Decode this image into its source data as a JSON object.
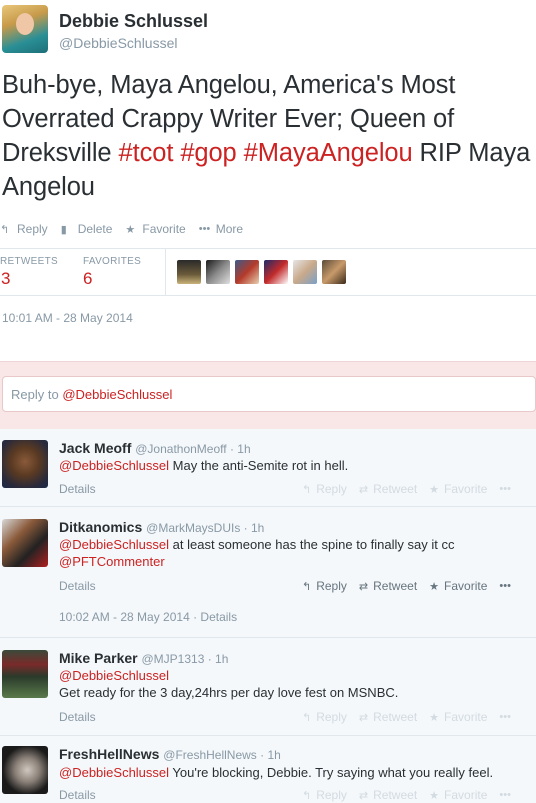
{
  "tweet": {
    "author_name": "Debbie Schlussel",
    "author_handle": "@DebbieSchlussel",
    "text_part1": "Buh-bye, Maya Angelou, America's Most Overrated Crappy Writer Ever; Queen of Dreksville ",
    "hashtag1": "#tcot",
    "hashtag2": "#gop",
    "hashtag3": "#MayaAngelou",
    "text_part2": " RIP Maya Angelou",
    "actions": {
      "reply": "Reply",
      "delete": "Delete",
      "favorite": "Favorite",
      "more": "More"
    },
    "stats": {
      "retweets_label": "RETWEETS",
      "retweets_value": "3",
      "favorites_label": "FAVORITES",
      "favorites_value": "6"
    },
    "timestamp": "10:01 AM - 28 May 2014"
  },
  "reply_box": {
    "prefix": "Reply to ",
    "mention": "@DebbieSchlussel"
  },
  "replies": [
    {
      "name": "Jack Meoff",
      "handle": "@JonathonMeoff · 1h",
      "mention": "@DebbieSchlussel",
      "text": " May the anti-Semite rot in hell.",
      "details": "Details",
      "reply": "Reply",
      "retweet": "Retweet",
      "favorite": "Favorite"
    },
    {
      "name": "Ditkanomics",
      "handle": "@MarkMaysDUIs · 1h",
      "mention": "@DebbieSchlussel",
      "text": " at least someone has the spine to finally say it cc ",
      "mention2": "@PFTCommenter",
      "details": "Details",
      "reply": "Reply",
      "retweet": "Retweet",
      "favorite": "Favorite",
      "timestamp": "10:02 AM - 28 May 2014 · Details"
    },
    {
      "name": "Mike Parker",
      "handle": "@MJP1313 · 1h",
      "mention": "@DebbieSchlussel",
      "text": "Get ready for the 3 day,24hrs per day love fest on MSNBC.",
      "details": "Details",
      "reply": "Reply",
      "retweet": "Retweet",
      "favorite": "Favorite"
    },
    {
      "name": "FreshHellNews",
      "handle": "@FreshHellNews · 1h",
      "mention": "@DebbieSchlussel",
      "text": " You're blocking, Debbie.  Try saying what you really feel.",
      "details": "Details",
      "reply": "Reply",
      "retweet": "Retweet",
      "favorite": "Favorite"
    }
  ],
  "icons": {
    "reply": "reply-icon",
    "delete": "trash-icon",
    "favorite": "star-icon",
    "more": "ellipsis-icon",
    "retweet": "retweet-icon"
  },
  "colors": {
    "accent": "#cc2222",
    "muted": "#8899a6",
    "text": "#292f33"
  }
}
